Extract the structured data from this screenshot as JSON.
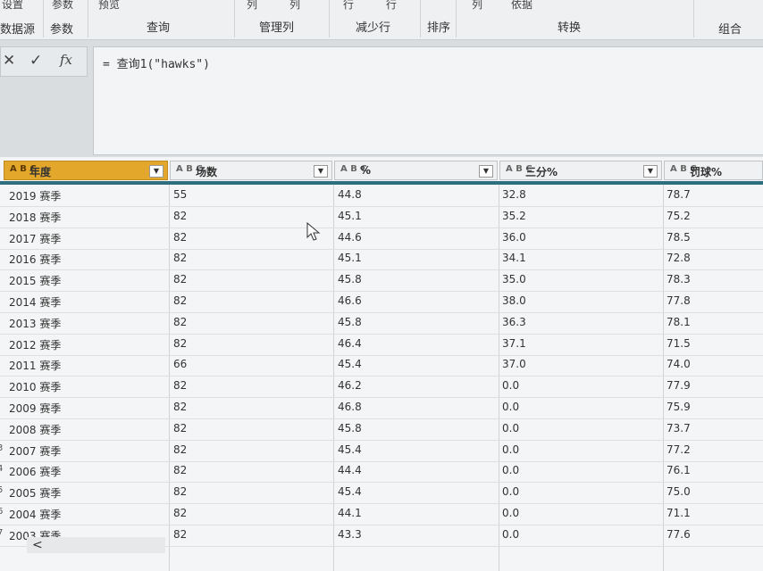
{
  "ribbon": {
    "top_labels": [
      "设置",
      "参数",
      "预览",
      "列",
      "列",
      "行",
      "行",
      "列",
      "依据"
    ],
    "groups": [
      {
        "id": "datasource",
        "label": "数据源"
      },
      {
        "id": "params",
        "label": "参数"
      },
      {
        "id": "query",
        "label": "查询"
      },
      {
        "id": "manage-cols",
        "label": "管理列"
      },
      {
        "id": "reduce-rows",
        "label": "减少行"
      },
      {
        "id": "sort",
        "label": "排序"
      },
      {
        "id": "transform",
        "label": "转换"
      },
      {
        "id": "combine",
        "label": "组合"
      }
    ]
  },
  "formula": {
    "cancel_icon": "✕",
    "confirm_icon": "✓",
    "fx_icon": "fx",
    "text": "= 查询1(\"hawks\")"
  },
  "table": {
    "type_label": "A B C",
    "columns": [
      {
        "name": "年度"
      },
      {
        "name": "场数"
      },
      {
        "name": "%"
      },
      {
        "name": "三分%"
      },
      {
        "name": "罚球%"
      }
    ],
    "rows": [
      {
        "num": "",
        "cells": [
          "2019 赛季",
          "55",
          "44.8",
          "32.8",
          "78.7"
        ]
      },
      {
        "num": "",
        "cells": [
          "2018 赛季",
          "82",
          "45.1",
          "35.2",
          "75.2"
        ]
      },
      {
        "num": "",
        "cells": [
          "2017 赛季",
          "82",
          "44.6",
          "36.0",
          "78.5"
        ]
      },
      {
        "num": "",
        "cells": [
          "2016 赛季",
          "82",
          "45.1",
          "34.1",
          "72.8"
        ]
      },
      {
        "num": "",
        "cells": [
          "2015 赛季",
          "82",
          "45.8",
          "35.0",
          "78.3"
        ]
      },
      {
        "num": "",
        "cells": [
          "2014 赛季",
          "82",
          "46.6",
          "38.0",
          "77.8"
        ]
      },
      {
        "num": "",
        "cells": [
          "2013 赛季",
          "82",
          "45.8",
          "36.3",
          "78.1"
        ]
      },
      {
        "num": "",
        "cells": [
          "2012 赛季",
          "82",
          "46.4",
          "37.1",
          "71.5"
        ]
      },
      {
        "num": "",
        "cells": [
          "2011 赛季",
          "66",
          "45.4",
          "37.0",
          "74.0"
        ]
      },
      {
        "num": "",
        "cells": [
          "2010 赛季",
          "82",
          "46.2",
          "0.0",
          "77.9"
        ]
      },
      {
        "num": "",
        "cells": [
          "2009 赛季",
          "82",
          "46.8",
          "0.0",
          "75.9"
        ]
      },
      {
        "num": "",
        "cells": [
          "2008 赛季",
          "82",
          "45.8",
          "0.0",
          "73.7"
        ]
      },
      {
        "num": "3",
        "cells": [
          "2007 赛季",
          "82",
          "45.4",
          "0.0",
          "77.2"
        ]
      },
      {
        "num": "4",
        "cells": [
          "2006 赛季",
          "82",
          "44.4",
          "0.0",
          "76.1"
        ]
      },
      {
        "num": "5",
        "cells": [
          "2005 赛季",
          "82",
          "45.4",
          "0.0",
          "75.0"
        ]
      },
      {
        "num": "6",
        "cells": [
          "2004 赛季",
          "82",
          "44.1",
          "0.0",
          "71.1"
        ]
      },
      {
        "num": "7",
        "cells": [
          "2003 赛季",
          "82",
          "43.3",
          "0.0",
          "77.6"
        ]
      }
    ]
  },
  "scroll": {
    "left_arrow": "<"
  }
}
